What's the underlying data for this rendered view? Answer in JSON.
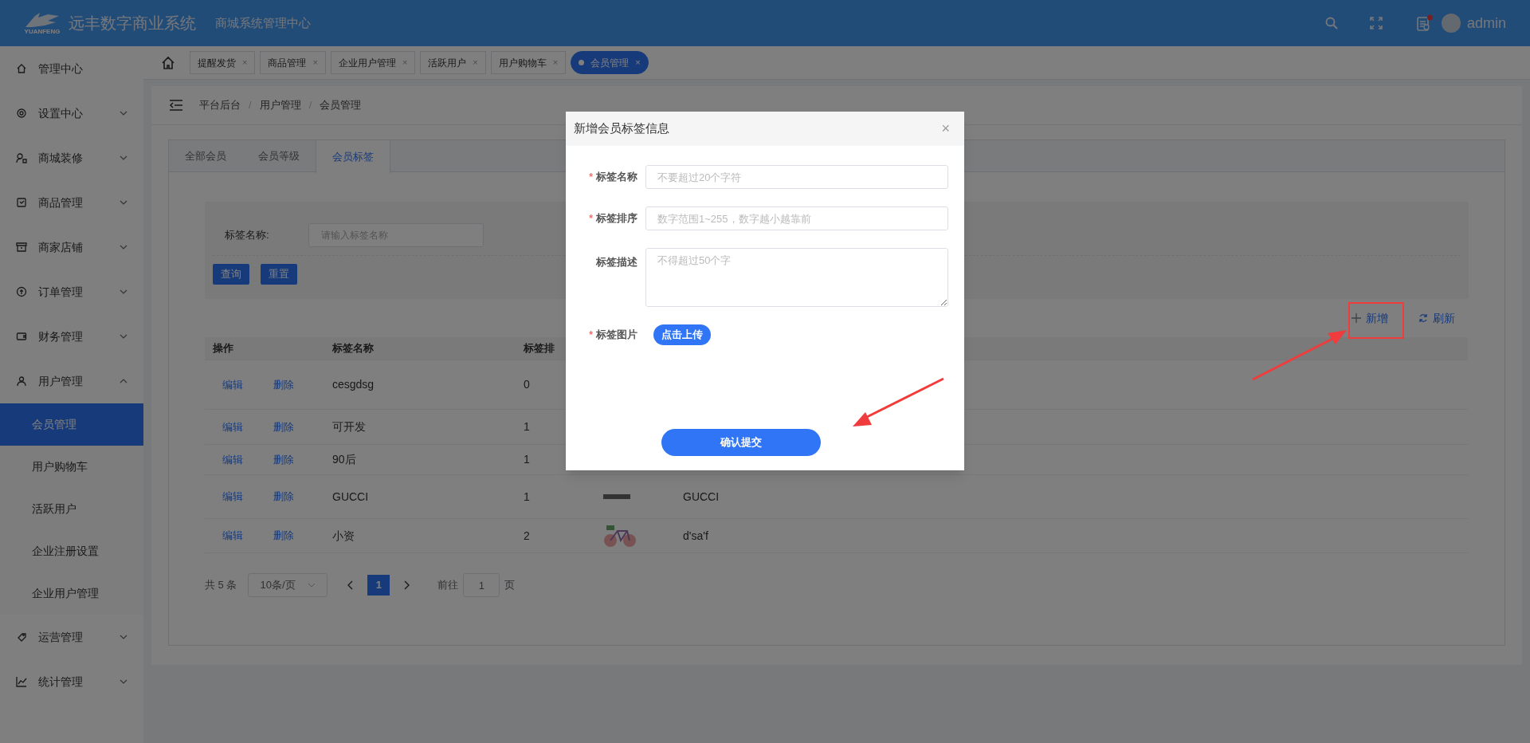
{
  "header": {
    "brand": "远丰数字商业系统",
    "brand_sub": "YUANFENG",
    "subtitle": "商城系统管理中心",
    "user": "admin"
  },
  "sidebar": {
    "items": [
      {
        "label": "管理中心",
        "selected": false
      },
      {
        "label": "设置中心",
        "selected": false,
        "expanded": false
      },
      {
        "label": "商城装修",
        "selected": false,
        "expanded": false
      },
      {
        "label": "商品管理",
        "selected": false,
        "expanded": false
      },
      {
        "label": "商家店铺",
        "selected": false,
        "expanded": false
      },
      {
        "label": "订单管理",
        "selected": false,
        "expanded": false
      },
      {
        "label": "财务管理",
        "selected": false,
        "expanded": false
      },
      {
        "label": "用户管理",
        "selected": false,
        "expanded": true,
        "children": [
          {
            "label": "会员管理",
            "selected": true
          },
          {
            "label": "用户购物车",
            "selected": false
          },
          {
            "label": "活跃用户",
            "selected": false
          },
          {
            "label": "企业注册设置",
            "selected": false
          },
          {
            "label": "企业用户管理",
            "selected": false
          }
        ]
      },
      {
        "label": "运营管理",
        "selected": false,
        "expanded": false
      },
      {
        "label": "统计管理",
        "selected": false,
        "expanded": false
      }
    ]
  },
  "page_tabs": [
    {
      "label": "提醒发货",
      "selected": false,
      "close": "×"
    },
    {
      "label": "商品管理",
      "selected": false,
      "close": "×"
    },
    {
      "label": "企业用户管理",
      "selected": false,
      "close": "×"
    },
    {
      "label": "活跃用户",
      "selected": false,
      "close": "×"
    },
    {
      "label": "用户购物车",
      "selected": false,
      "close": "×"
    },
    {
      "label": "会员管理",
      "selected": true,
      "close": "×"
    }
  ],
  "breadcrumb": [
    "平台后台",
    "用户管理",
    "会员管理"
  ],
  "breadcrumb_separator": "/",
  "member_tabs": [
    {
      "label": "全部会员",
      "selected": false
    },
    {
      "label": "会员等级",
      "selected": false
    },
    {
      "label": "会员标签",
      "selected": true
    }
  ],
  "search": {
    "label": "标签名称:",
    "placeholder": "请输入标签名称",
    "buttons": [
      "查询",
      "重置"
    ]
  },
  "actions": {
    "add": "新增",
    "refresh": "刷新"
  },
  "table": {
    "columns": [
      "操作",
      "标签名称",
      "标签排"
    ],
    "rows": [
      {
        "kind": "plain",
        "edit": "编辑",
        "delete": "删除",
        "name": "cesgdsg",
        "sort": "0"
      },
      {
        "kind": "plain",
        "edit": "编辑",
        "delete": "删除",
        "name": "可开发",
        "sort": "1"
      },
      {
        "kind": "partial",
        "edit": "编辑",
        "delete": "删除",
        "name": "90后",
        "sort": "1"
      },
      {
        "kind": "logo",
        "edit": "编辑",
        "delete": "删除",
        "name": "GUCCI",
        "sort": "1",
        "description": "GUCCI"
      },
      {
        "kind": "bicycle",
        "edit": "编辑",
        "delete": "删除",
        "name": "小资",
        "sort": "2",
        "description": "d'sa'f"
      }
    ]
  },
  "pagination": {
    "total": "共 5 条",
    "page_size": "10条/页",
    "current": "1",
    "goto_label": "前往",
    "goto_value": "1",
    "goto_suffix": "页"
  },
  "dialog": {
    "title": "新增会员标签信息",
    "close": "×",
    "required_mark": "*",
    "fields": [
      {
        "kind": "input",
        "label": "标签名称",
        "required": true,
        "placeholder": "不要超过20个字符"
      },
      {
        "kind": "input",
        "label": "标签排序",
        "required": true,
        "placeholder": "数字范围1~255，数字越小越靠前"
      },
      {
        "kind": "textarea",
        "label": "标签描述",
        "required": false,
        "placeholder": "不得超过50个字"
      },
      {
        "kind": "upload",
        "label": "标签图片",
        "required": true,
        "button": "点击上传"
      }
    ],
    "submit": "确认提交"
  }
}
